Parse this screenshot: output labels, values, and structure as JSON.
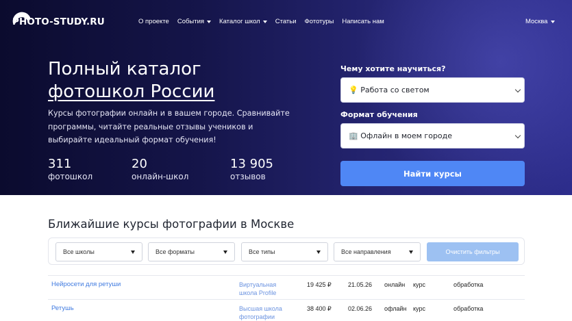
{
  "header": {
    "logo_text": "PHOTO-STUDY.RU",
    "nav": [
      {
        "label": "О проекте",
        "dropdown": false
      },
      {
        "label": "События",
        "dropdown": true
      },
      {
        "label": "Каталог школ",
        "dropdown": true
      },
      {
        "label": "Статьи",
        "dropdown": false
      },
      {
        "label": "Фототуры",
        "dropdown": false
      },
      {
        "label": "Написать нам",
        "dropdown": false
      }
    ],
    "city": "Москва"
  },
  "hero": {
    "title_line1": "Полный каталог",
    "title_line2": "фотошкол России",
    "description": "Курсы фотографии онлайн и в вашем городе. Сравнивайте программы, читайте реальные отзывы учеников и выбирайте идеальный формат обучения!",
    "stats": [
      {
        "value": "311",
        "label": "фотошкол"
      },
      {
        "value": "20",
        "label": "онлайн-школ"
      },
      {
        "value": "13 905",
        "label": "отзывов"
      }
    ]
  },
  "search_form": {
    "topic_label": "Чему хотите научиться?",
    "topic_value": "💡 Работа со светом",
    "format_label": "Формат обучения",
    "format_value": "🏢 Офлайн в моем городе",
    "submit_label": "Найти курсы"
  },
  "courses_section": {
    "title": "Ближайшие курсы фотографии в Москве",
    "filters": [
      "Все школы",
      "Все форматы",
      "Все типы",
      "Все направления"
    ],
    "clear_label": "Очистить фильтры",
    "rows": [
      {
        "name": "Нейросети для ретуши",
        "school": "Виртуальная школа Profile",
        "price": "19 425 ₽",
        "date": "21.05.26",
        "format": "онлайн",
        "type": "курс",
        "direction": "обработка"
      },
      {
        "name": "Ретушь",
        "school": "Высшая школа фотографии",
        "price": "38 400 ₽",
        "date": "02.06.26",
        "format": "офлайн",
        "type": "курс",
        "direction": "обработка"
      }
    ]
  },
  "colors": {
    "hero_dark": "#0b0b2e",
    "hero_light": "#2d2d8c",
    "accent_button": "#4f87f5",
    "clear_button": "#9dc1f2",
    "link": "#3f7ae0"
  }
}
